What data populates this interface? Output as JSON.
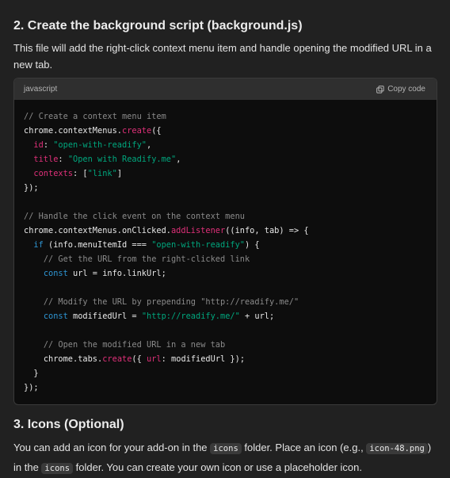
{
  "section_bg": {
    "title": "2. Create the background script (background.js)",
    "desc": "This file will add the right-click context menu item and handle opening the modified URL in a new tab."
  },
  "code": {
    "language": "javascript",
    "copy_label": "Copy code",
    "comment1": "// Create a context menu item",
    "l2a": "chrome.contextMenus.",
    "l2fn": "create",
    "l2b": "({",
    "id_key": "id",
    "id_val": "\"open-with-readify\"",
    "title_key": "title",
    "title_val": "\"Open with Readify.me\"",
    "contexts_key": "contexts",
    "contexts_val": "\"link\"",
    "close1": "});",
    "comment2": "// Handle the click event on the context menu",
    "l9a": "chrome.contextMenus.onClicked.",
    "l9fn": "addListener",
    "l9b": "((info, tab) => {",
    "if_kw": "if",
    "l10a": " (info.menuItemId === ",
    "l10s": "\"open-with-readify\"",
    "l10b": ") {",
    "comment3": "// Get the URL from the right-clicked link",
    "const_kw": "const",
    "l12b": " url = info.linkUrl;",
    "comment4": "// Modify the URL by prepending \"http://readify.me/\"",
    "l15b": " modifiedUrl = ",
    "l15s": "\"http://readify.me/\"",
    "l15c": " + url;",
    "comment5": "// Open the modified URL in a new tab",
    "l18a": "chrome.tabs.",
    "l18fn": "create",
    "l18b": "({ ",
    "l18key": "url",
    "l18c": ": modifiedUrl });",
    "close2": "}",
    "close3": "});"
  },
  "section_icons": {
    "title": "3. Icons (Optional)",
    "t1": "You can add an icon for your add-on in the ",
    "c1": "icons",
    "t2": " folder. Place an icon (e.g., ",
    "c2": "icon-48.png",
    "t3": ") in the ",
    "c3": "icons",
    "t4": " folder. You can create your own icon or use a placeholder icon."
  }
}
